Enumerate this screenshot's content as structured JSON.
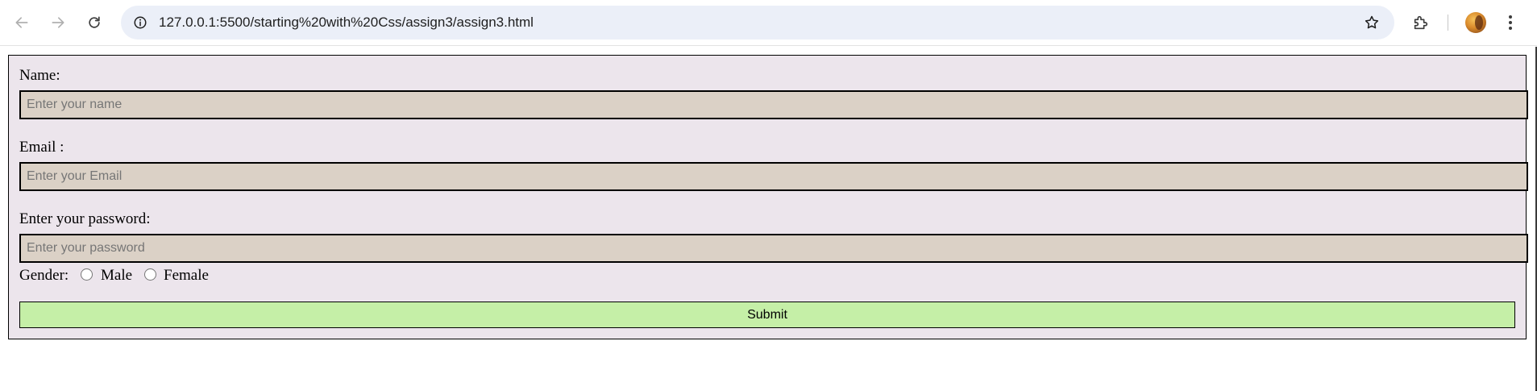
{
  "browser": {
    "url": "127.0.0.1:5500/starting%20with%20Css/assign3/assign3.html",
    "icons": {
      "back": "arrow-left-icon",
      "forward": "arrow-right-icon",
      "reload": "reload-icon",
      "site_info": "info-icon",
      "bookmark": "star-icon",
      "extensions": "puzzle-icon",
      "menu": "more-vertical-icon"
    }
  },
  "form": {
    "name_label": "Name:",
    "name_placeholder": "Enter your name",
    "email_label": "Email :",
    "email_placeholder": "Enter your Email",
    "password_label": "Enter your password:",
    "password_placeholder": "Enter your password",
    "gender_label": "Gender:",
    "gender_options": [
      "Male",
      "Female"
    ],
    "submit_label": "Submit"
  },
  "colors": {
    "form_background": "#ece5ec",
    "input_background": "#dbd1c6",
    "submit_background": "#c5efa7"
  }
}
